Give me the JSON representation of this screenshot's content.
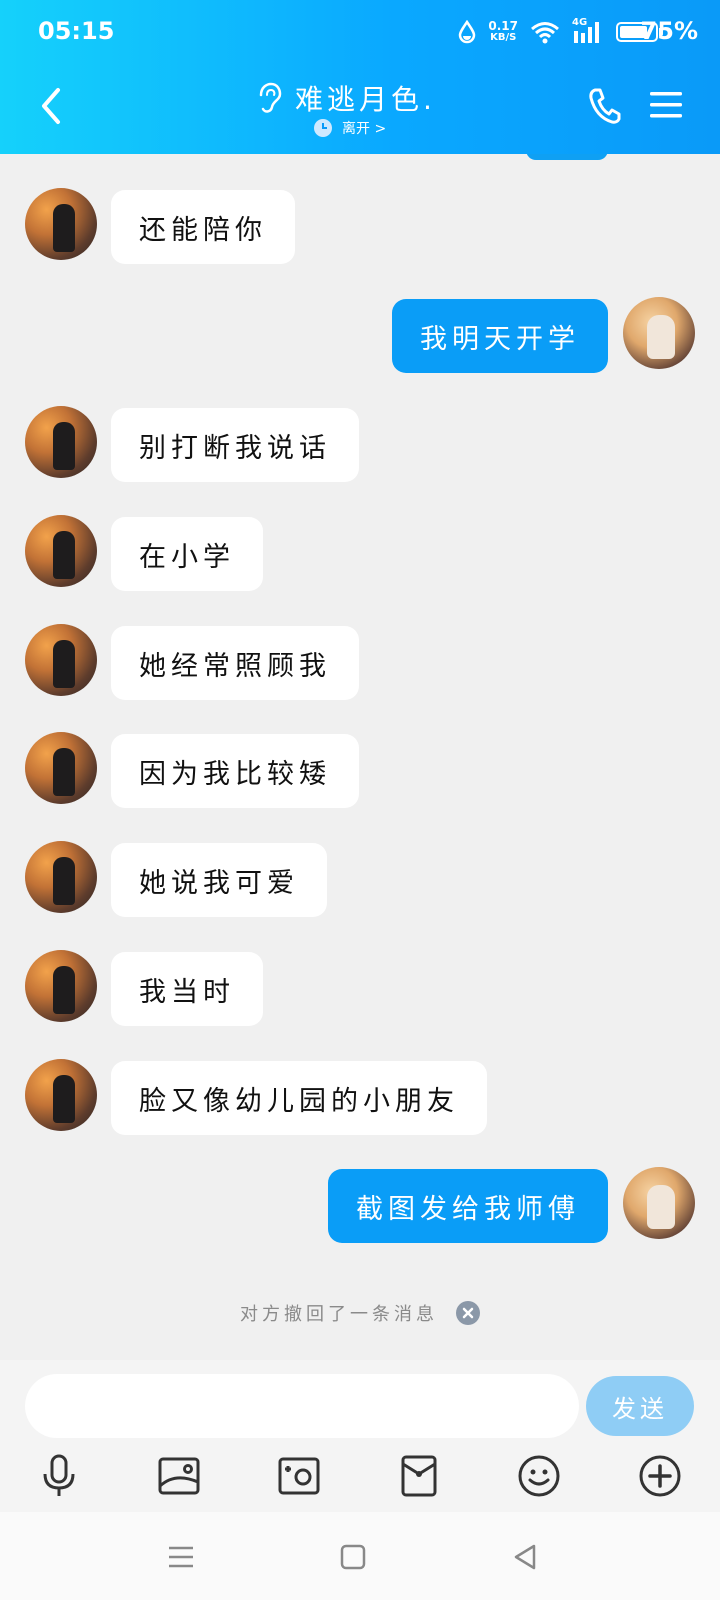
{
  "status_bar": {
    "time": "05:15",
    "net_speed_value": "0.17",
    "net_speed_unit": "KB/S",
    "signal_label": "4G",
    "battery_percent": "75%",
    "battery_level": 0.75
  },
  "header": {
    "title": "难逃月色.",
    "subtitle": "离开 >"
  },
  "messages": [
    {
      "side": "in",
      "text": "还能陪你"
    },
    {
      "side": "out",
      "text": "我明天开学"
    },
    {
      "side": "in",
      "text": "别打断我说话"
    },
    {
      "side": "in",
      "text": "在小学"
    },
    {
      "side": "in",
      "text": "她经常照顾我"
    },
    {
      "side": "in",
      "text": "因为我比较矮"
    },
    {
      "side": "in",
      "text": "她说我可爱"
    },
    {
      "side": "in",
      "text": "我当时"
    },
    {
      "side": "in",
      "text": "脸又像幼儿园的小朋友"
    },
    {
      "side": "out",
      "text": "截图发给我师傅"
    }
  ],
  "recall_notice": "对方撤回了一条消息",
  "composer": {
    "input_value": "",
    "send_label": "发送"
  },
  "toolbar_icons": [
    "microphone-icon",
    "image-icon",
    "camera-icon",
    "red-packet-icon",
    "emoji-icon",
    "plus-icon"
  ],
  "colors": {
    "header_start": "#15d1fb",
    "header_end": "#0a9af8",
    "outgoing_bubble": "#0a9df7",
    "incoming_bubble": "#ffffff",
    "send_button": "#8fcdf5",
    "chat_background": "#f0f0f0"
  }
}
